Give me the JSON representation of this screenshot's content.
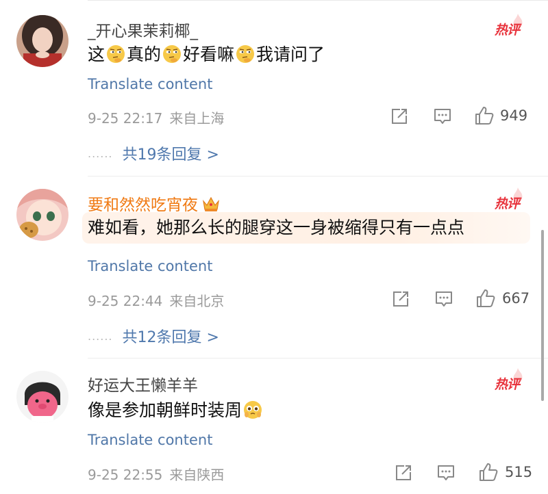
{
  "comments": [
    {
      "username": "_开心果茉莉椰_",
      "hot_label": "热评",
      "text_parts": [
        "这",
        "真的",
        "好看嘛",
        "我请问了"
      ],
      "translate_label": "Translate content",
      "time": "9-25 22:17",
      "location": "来自上海",
      "likes": "949",
      "replies_label": "共19条回复 >",
      "emoji": "thinking-emoji"
    },
    {
      "username": "要和然然吃宵夜",
      "hot_label": "热评",
      "text": "难如看，她那么长的腿穿这一身被缩得只有一点点",
      "translate_label": "Translate content",
      "time": "9-25 22:44",
      "location": "来自北京",
      "likes": "667",
      "replies_label": "共12条回复 >",
      "badge": "crown-icon"
    },
    {
      "username": "好运大王懒羊羊",
      "hot_label": "热评",
      "text": "像是参加朝鲜时装周",
      "translate_label": "Translate content",
      "time": "9-25 22:55",
      "location": "来自陕西",
      "likes": "515",
      "emoji": "pleading-emoji"
    }
  ],
  "reply_dots": "......",
  "colors": {
    "link": "#5077a8",
    "vip_name": "#f07a13",
    "hot": "#e8343d",
    "meta": "#9a9a9a"
  }
}
